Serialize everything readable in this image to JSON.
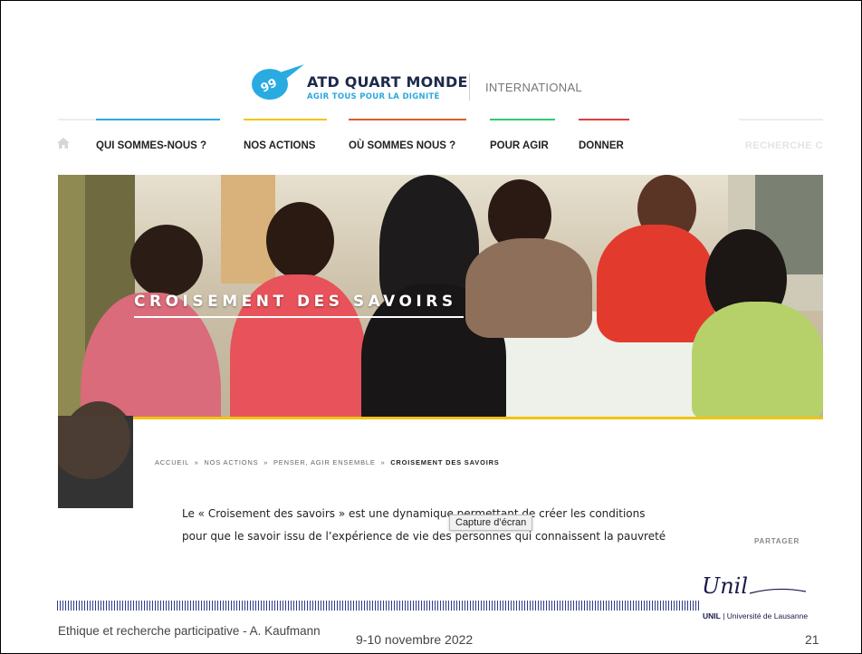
{
  "site": {
    "brand_name": "ATD QUART MONDE",
    "brand_tagline": "AGIR TOUS POUR LA DIGNITÉ",
    "brand_region": "INTERNATIONAL",
    "accent_colors": [
      "#29abe2",
      "#f1c40f",
      "#e05a2b",
      "#2ecc71",
      "#e03c3c"
    ]
  },
  "nav": {
    "home_icon": "home-icon",
    "items": [
      {
        "label": "QUI SOMMES-NOUS ?",
        "color": "#29abe2"
      },
      {
        "label": "NOS ACTIONS",
        "color": "#f1c40f"
      },
      {
        "label": "OÙ SOMMES NOUS ?",
        "color": "#e05a2b"
      },
      {
        "label": "POUR AGIR",
        "color": "#2ecc71"
      },
      {
        "label": "DONNER",
        "color": "#e03c3c"
      }
    ],
    "search_label": "RECHERCHE C"
  },
  "hero": {
    "title": "CROISEMENT DES SAVOIRS"
  },
  "breadcrumb": {
    "items": [
      "ACCUEIL",
      "NOS ACTIONS",
      "PENSER, AGIR ENSEMBLE"
    ],
    "separator": "»",
    "current": "CROISEMENT DES SAVOIRS"
  },
  "article": {
    "line1": "Le « Croisement des savoirs » est une dynamique permettant de créer les conditions",
    "line2": "pour que le savoir issu de l’expérience de vie des personnes qui connaissent la pauvreté"
  },
  "share_label": "PARTAGER",
  "tooltip": "Capture d’écran",
  "footer": {
    "left": "Ethique et recherche participative - A. Kaufmann",
    "center": "9-10 novembre 2022",
    "page": "21",
    "unil_script": "Unil",
    "unil_bold": "UNIL",
    "unil_rest": " | Université de Lausanne"
  }
}
